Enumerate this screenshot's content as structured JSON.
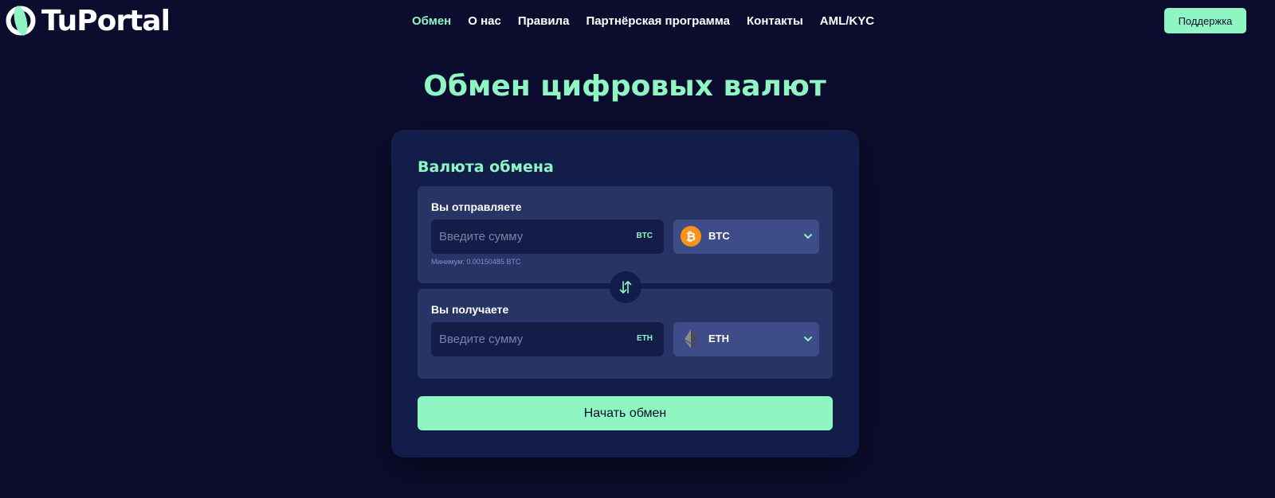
{
  "header": {
    "logo_text": "TuPortal",
    "nav": [
      {
        "label": "Обмен",
        "active": true
      },
      {
        "label": "О нас",
        "active": false
      },
      {
        "label": "Правила",
        "active": false
      },
      {
        "label": "Партнёрская программа",
        "active": false
      },
      {
        "label": "Контакты",
        "active": false
      },
      {
        "label": "AML/KYC",
        "active": false
      }
    ],
    "support_label": "Поддержка"
  },
  "main": {
    "title": "Обмен цифровых валют"
  },
  "exchange": {
    "title": "Валюта обмена",
    "send": {
      "label": "Вы отправляете",
      "placeholder": "Введите сумму",
      "unit": "BTC",
      "currency": "BTC",
      "currency_icon": "bitcoin-icon",
      "minimum": "Минимум: 0.00150485 BTC"
    },
    "receive": {
      "label": "Вы получаете",
      "placeholder": "Введите сумму",
      "unit": "ETH",
      "currency": "ETH",
      "currency_icon": "ethereum-icon"
    },
    "swap_icon": "swap-arrows-icon",
    "submit_label": "Начать обмен"
  },
  "colors": {
    "background": "#0c0d2e",
    "accent": "#8ff5c3",
    "card": "#131d4a",
    "panel": "#263466",
    "input": "#141d47",
    "select": "#3e4c87",
    "bitcoin": "#f7931a"
  }
}
